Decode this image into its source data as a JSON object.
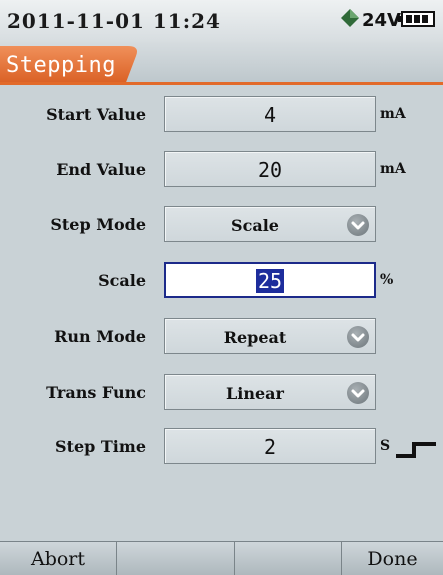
{
  "status": {
    "datetime": "2011-11-01 11:24",
    "voltage": "24V",
    "icons": [
      "loop-power-icon",
      "battery-icon"
    ]
  },
  "title": "Stepping",
  "form": {
    "start_value": {
      "label": "Start Value",
      "value": "4",
      "unit": "mA"
    },
    "end_value": {
      "label": "End Value",
      "value": "20",
      "unit": "mA"
    },
    "step_mode": {
      "label": "Step Mode",
      "value": "Scale"
    },
    "scale": {
      "label": "Scale",
      "value": "25",
      "unit": "%"
    },
    "run_mode": {
      "label": "Run Mode",
      "value": "Repeat"
    },
    "trans_func": {
      "label": "Trans Func",
      "value": "Linear"
    },
    "step_time": {
      "label": "Step Time",
      "value": "2",
      "unit": "S"
    }
  },
  "softkeys": [
    "Abort",
    "",
    "",
    "Done"
  ],
  "colors": {
    "accent": "#e26a2a",
    "selection": "#1d2d9c",
    "voltage_icon": "#3f7a45"
  }
}
